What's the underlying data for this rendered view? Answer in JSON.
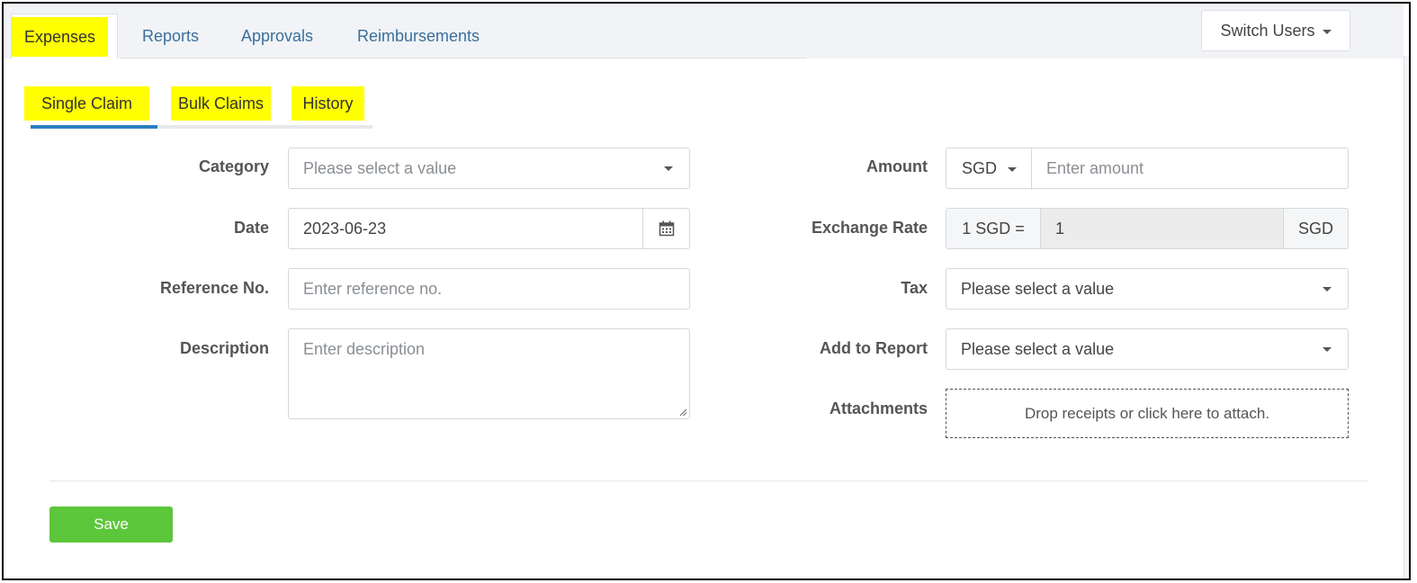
{
  "main_tabs": [
    {
      "label": "Expenses",
      "active": true
    },
    {
      "label": "Reports"
    },
    {
      "label": "Approvals"
    },
    {
      "label": "Reimbursements"
    }
  ],
  "switch_users": "Switch Users",
  "sub_tabs": [
    {
      "label": "Single Claim",
      "active": true
    },
    {
      "label": "Bulk Claims"
    },
    {
      "label": "History"
    }
  ],
  "form": {
    "category": {
      "label": "Category",
      "placeholder": "Please select a value"
    },
    "date": {
      "label": "Date",
      "value": "2023-06-23"
    },
    "reference": {
      "label": "Reference No.",
      "placeholder": "Enter reference no."
    },
    "description": {
      "label": "Description",
      "placeholder": "Enter description"
    },
    "amount": {
      "label": "Amount",
      "currency": "SGD",
      "placeholder": "Enter amount"
    },
    "exchange_rate": {
      "label": "Exchange Rate",
      "prefix": "1 SGD =",
      "value": "1",
      "suffix": "SGD"
    },
    "tax": {
      "label": "Tax",
      "placeholder": "Please select a value"
    },
    "add_to_report": {
      "label": "Add to Report",
      "placeholder": "Please select a value"
    },
    "attachments": {
      "label": "Attachments",
      "dropzone_text": "Drop receipts or click here to attach."
    }
  },
  "save_label": "Save",
  "colors": {
    "highlight": "#ffff00",
    "accent": "#2a7fc1",
    "save": "#5cc73a",
    "link": "#3b6f9c"
  }
}
